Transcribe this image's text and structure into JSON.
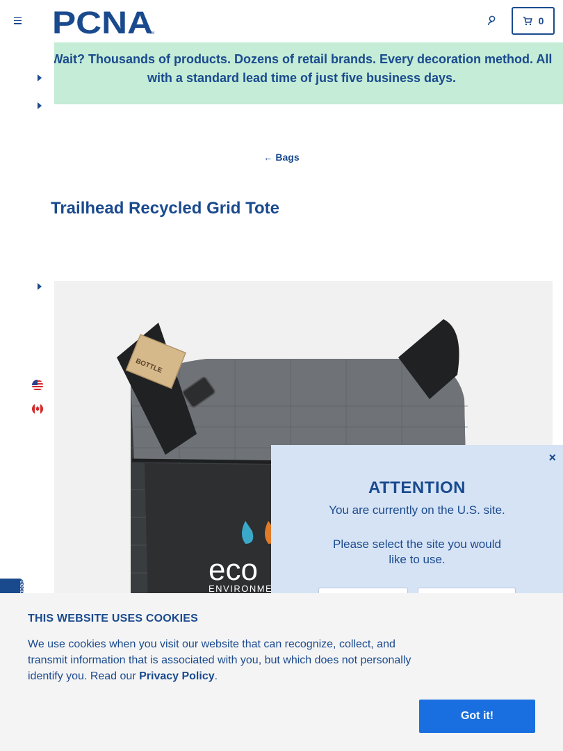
{
  "header": {
    "logo_text": "PCNA",
    "logo_tm": "TM",
    "cart_count": "0"
  },
  "promo": {
    "text": "Wait? Thousands of products. Dozens of retail brands. Every decoration method. All with a standard lead time of just five business days."
  },
  "breadcrumb": {
    "arrow": "←",
    "label": "Bags"
  },
  "product": {
    "title": "Trailhead Recycled Grid Tote",
    "bag_print_text": "eco",
    "bag_print_sub": "ENVIRONME",
    "tag_text": "BOTTLE"
  },
  "feedback_tab": {
    "label": "Feedback"
  },
  "attention": {
    "close": "×",
    "title": "ATTENTION",
    "message": "You are currently on the U.S. site.",
    "sub": "Please select the site you would like to use."
  },
  "cookie": {
    "title": "THIS WEBSITE USES COOKIES",
    "body_prefix": "We use cookies when you visit our website that can recognize, collect, and transmit information that is associated with you, but which does not personally identify you. Read our ",
    "link": "Privacy Policy",
    "body_suffix": ".",
    "button": "Got it!"
  },
  "colors": {
    "brand_blue": "#1a4a8e",
    "promo_green": "#c4ecd6",
    "button_blue": "#1a6fe0",
    "attention_bg": "#d6e3f5"
  }
}
